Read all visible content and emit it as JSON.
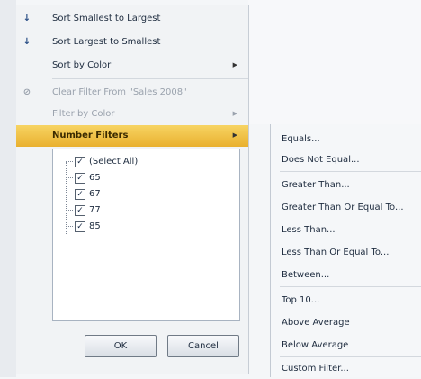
{
  "menu": {
    "sort_asc": "Sort Smallest to Largest",
    "sort_desc": "Sort Largest to Smallest",
    "sort_by_color": "Sort by Color",
    "clear_filter": "Clear Filter From \"Sales 2008\"",
    "filter_by_color": "Filter by Color",
    "number_filters": "Number Filters"
  },
  "values": [
    "(Select All)",
    "65",
    "67",
    "77",
    "85"
  ],
  "buttons": {
    "ok": "OK",
    "cancel": "Cancel"
  },
  "submenu": {
    "equals": "Equals...",
    "not_equal": "Does Not Equal...",
    "greater": "Greater Than...",
    "greater_eq": "Greater Than Or Equal To...",
    "less": "Less Than...",
    "less_eq": "Less Than Or Equal To...",
    "between": "Between...",
    "top10": "Top 10...",
    "above_avg": "Above Average",
    "below_avg": "Below Average",
    "custom": "Custom Filter..."
  },
  "colors": {
    "highlight": "#f0c044",
    "accent": "#2a4f86"
  }
}
